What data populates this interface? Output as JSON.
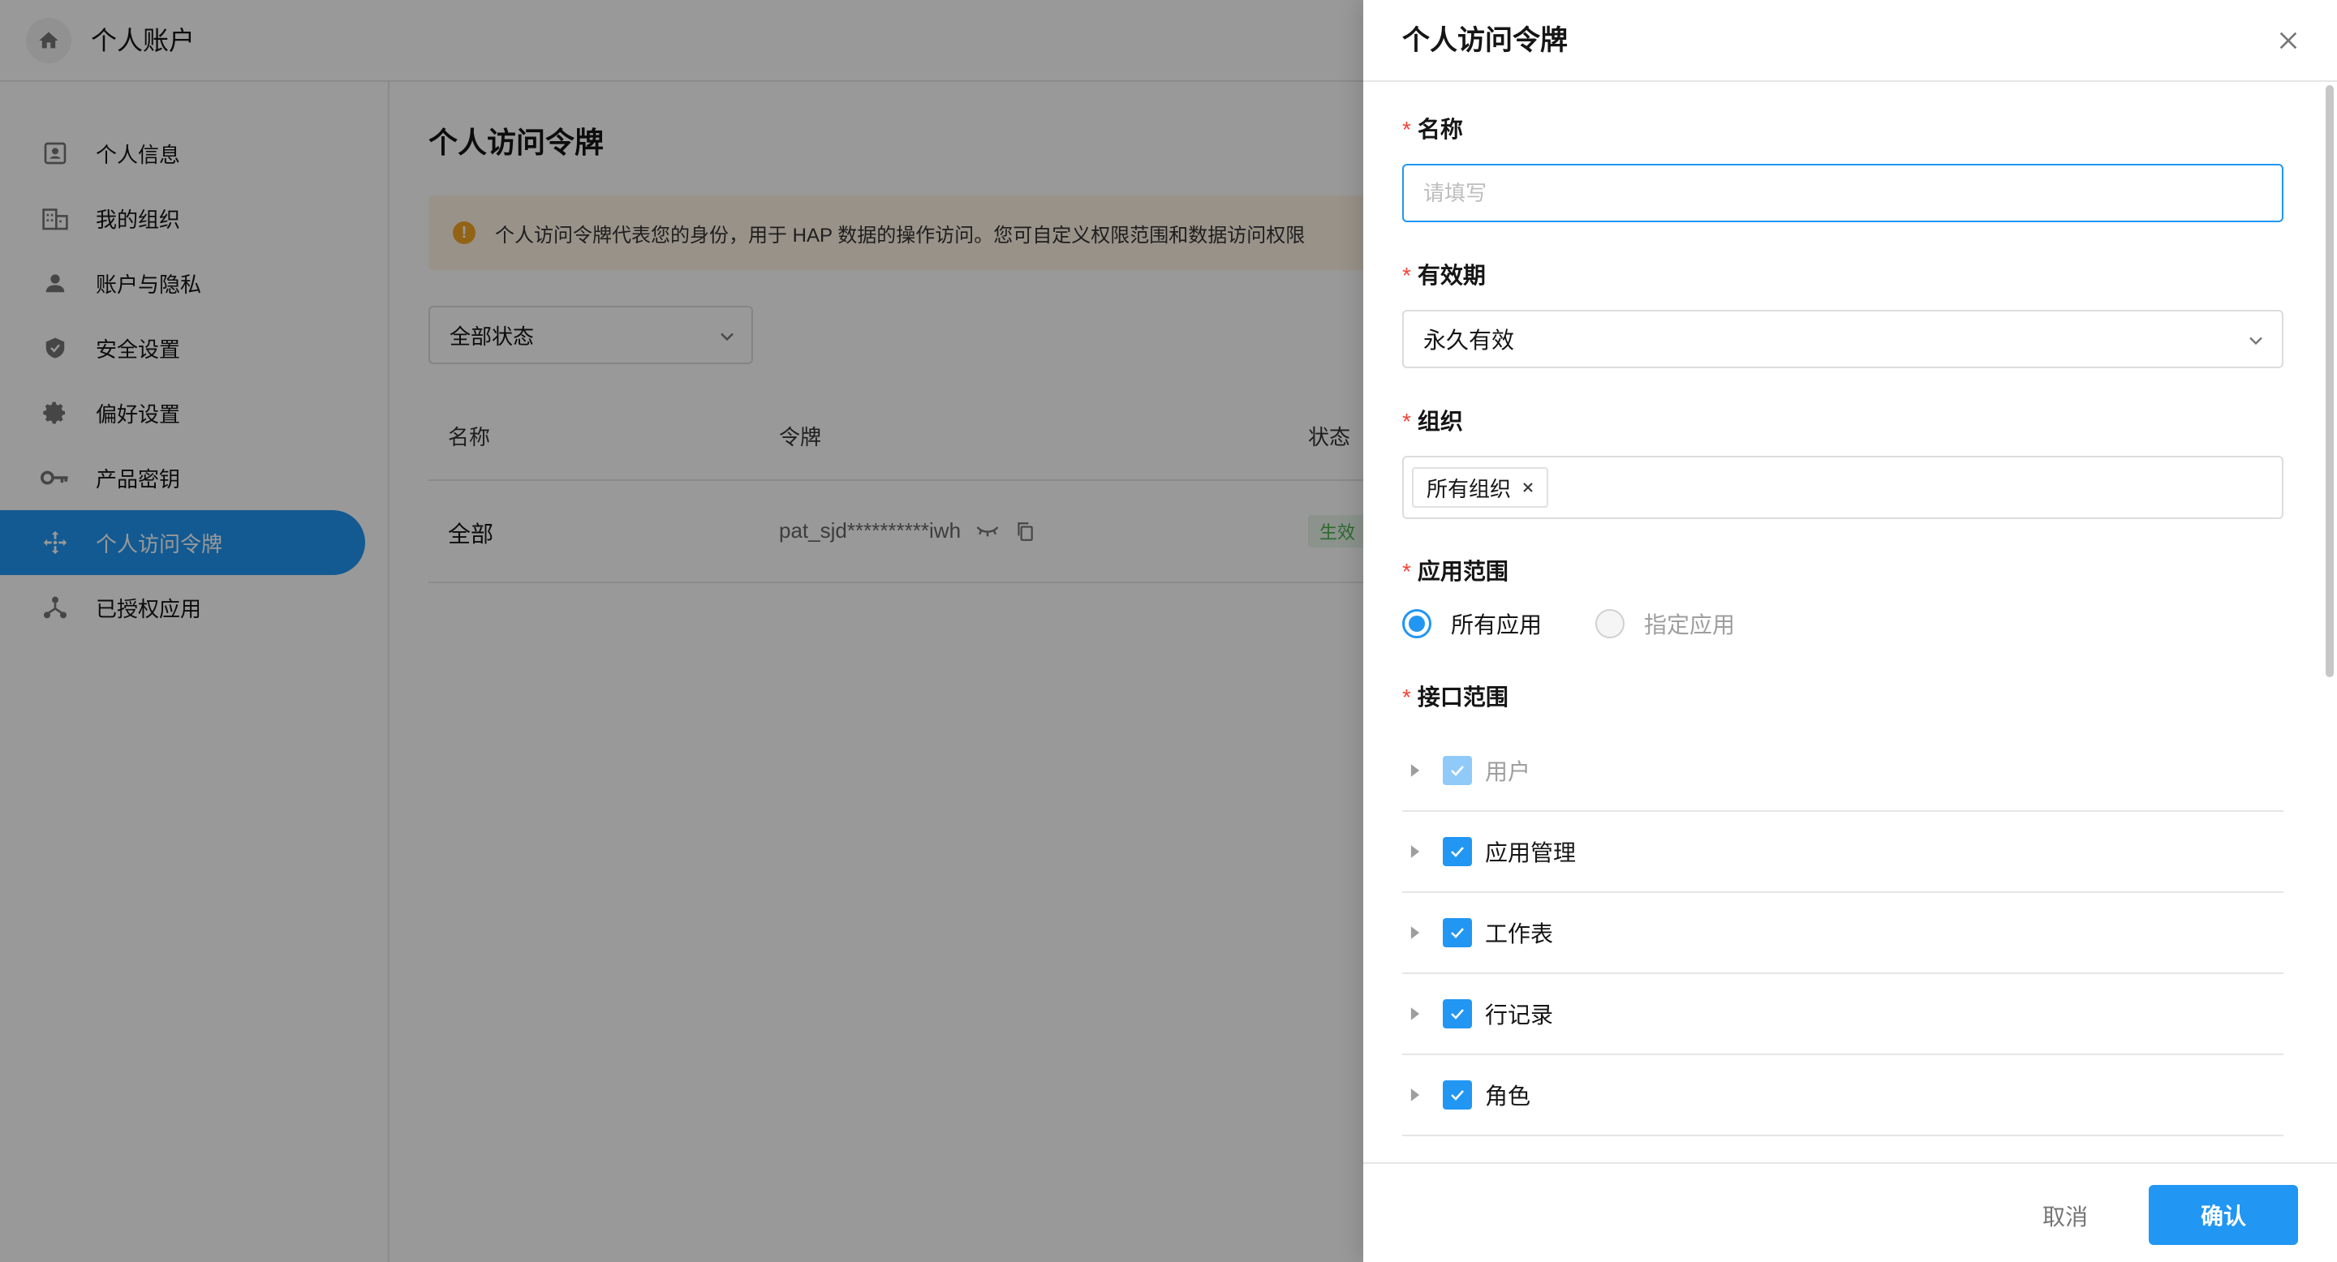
{
  "app": {
    "title": "个人账户"
  },
  "sidebar": {
    "items": [
      {
        "label": "个人信息",
        "icon": "id-card-icon"
      },
      {
        "label": "我的组织",
        "icon": "building-icon"
      },
      {
        "label": "账户与隐私",
        "icon": "user-icon"
      },
      {
        "label": "安全设置",
        "icon": "shield-icon"
      },
      {
        "label": "偏好设置",
        "icon": "gear-icon"
      },
      {
        "label": "产品密钥",
        "icon": "key-icon"
      },
      {
        "label": "个人访问令牌",
        "icon": "move-arrows-icon",
        "active": true
      },
      {
        "label": "已授权应用",
        "icon": "nodes-icon"
      }
    ]
  },
  "main": {
    "title": "个人访问令牌",
    "notice": "个人访问令牌代表您的身份，用于 HAP 数据的操作访问。您可自定义权限范围和数据访问权限",
    "status_filter": "全部状态",
    "columns": [
      "名称",
      "令牌",
      "状态"
    ],
    "rows": [
      {
        "name": "全部",
        "token": "pat_sjd**********iwh",
        "status": "生效"
      }
    ]
  },
  "drawer": {
    "title": "个人访问令牌",
    "name_label": "名称",
    "name_placeholder": "请填写",
    "expiry_label": "有效期",
    "expiry_value": "永久有效",
    "org_label": "组织",
    "org_tag": "所有组织",
    "scope_label": "应用范围",
    "scope_options": [
      "所有应用",
      "指定应用"
    ],
    "api_label": "接口范围",
    "api_items": [
      {
        "label": "用户",
        "checked": true,
        "disabled": true
      },
      {
        "label": "应用管理",
        "checked": true
      },
      {
        "label": "工作表",
        "checked": true
      },
      {
        "label": "行记录",
        "checked": true
      },
      {
        "label": "角色",
        "checked": true
      }
    ],
    "cancel_label": "取消",
    "confirm_label": "确认"
  },
  "colors": {
    "accent": "#2196f3",
    "required": "#f44336",
    "notice_bg": "#fff4e5"
  }
}
